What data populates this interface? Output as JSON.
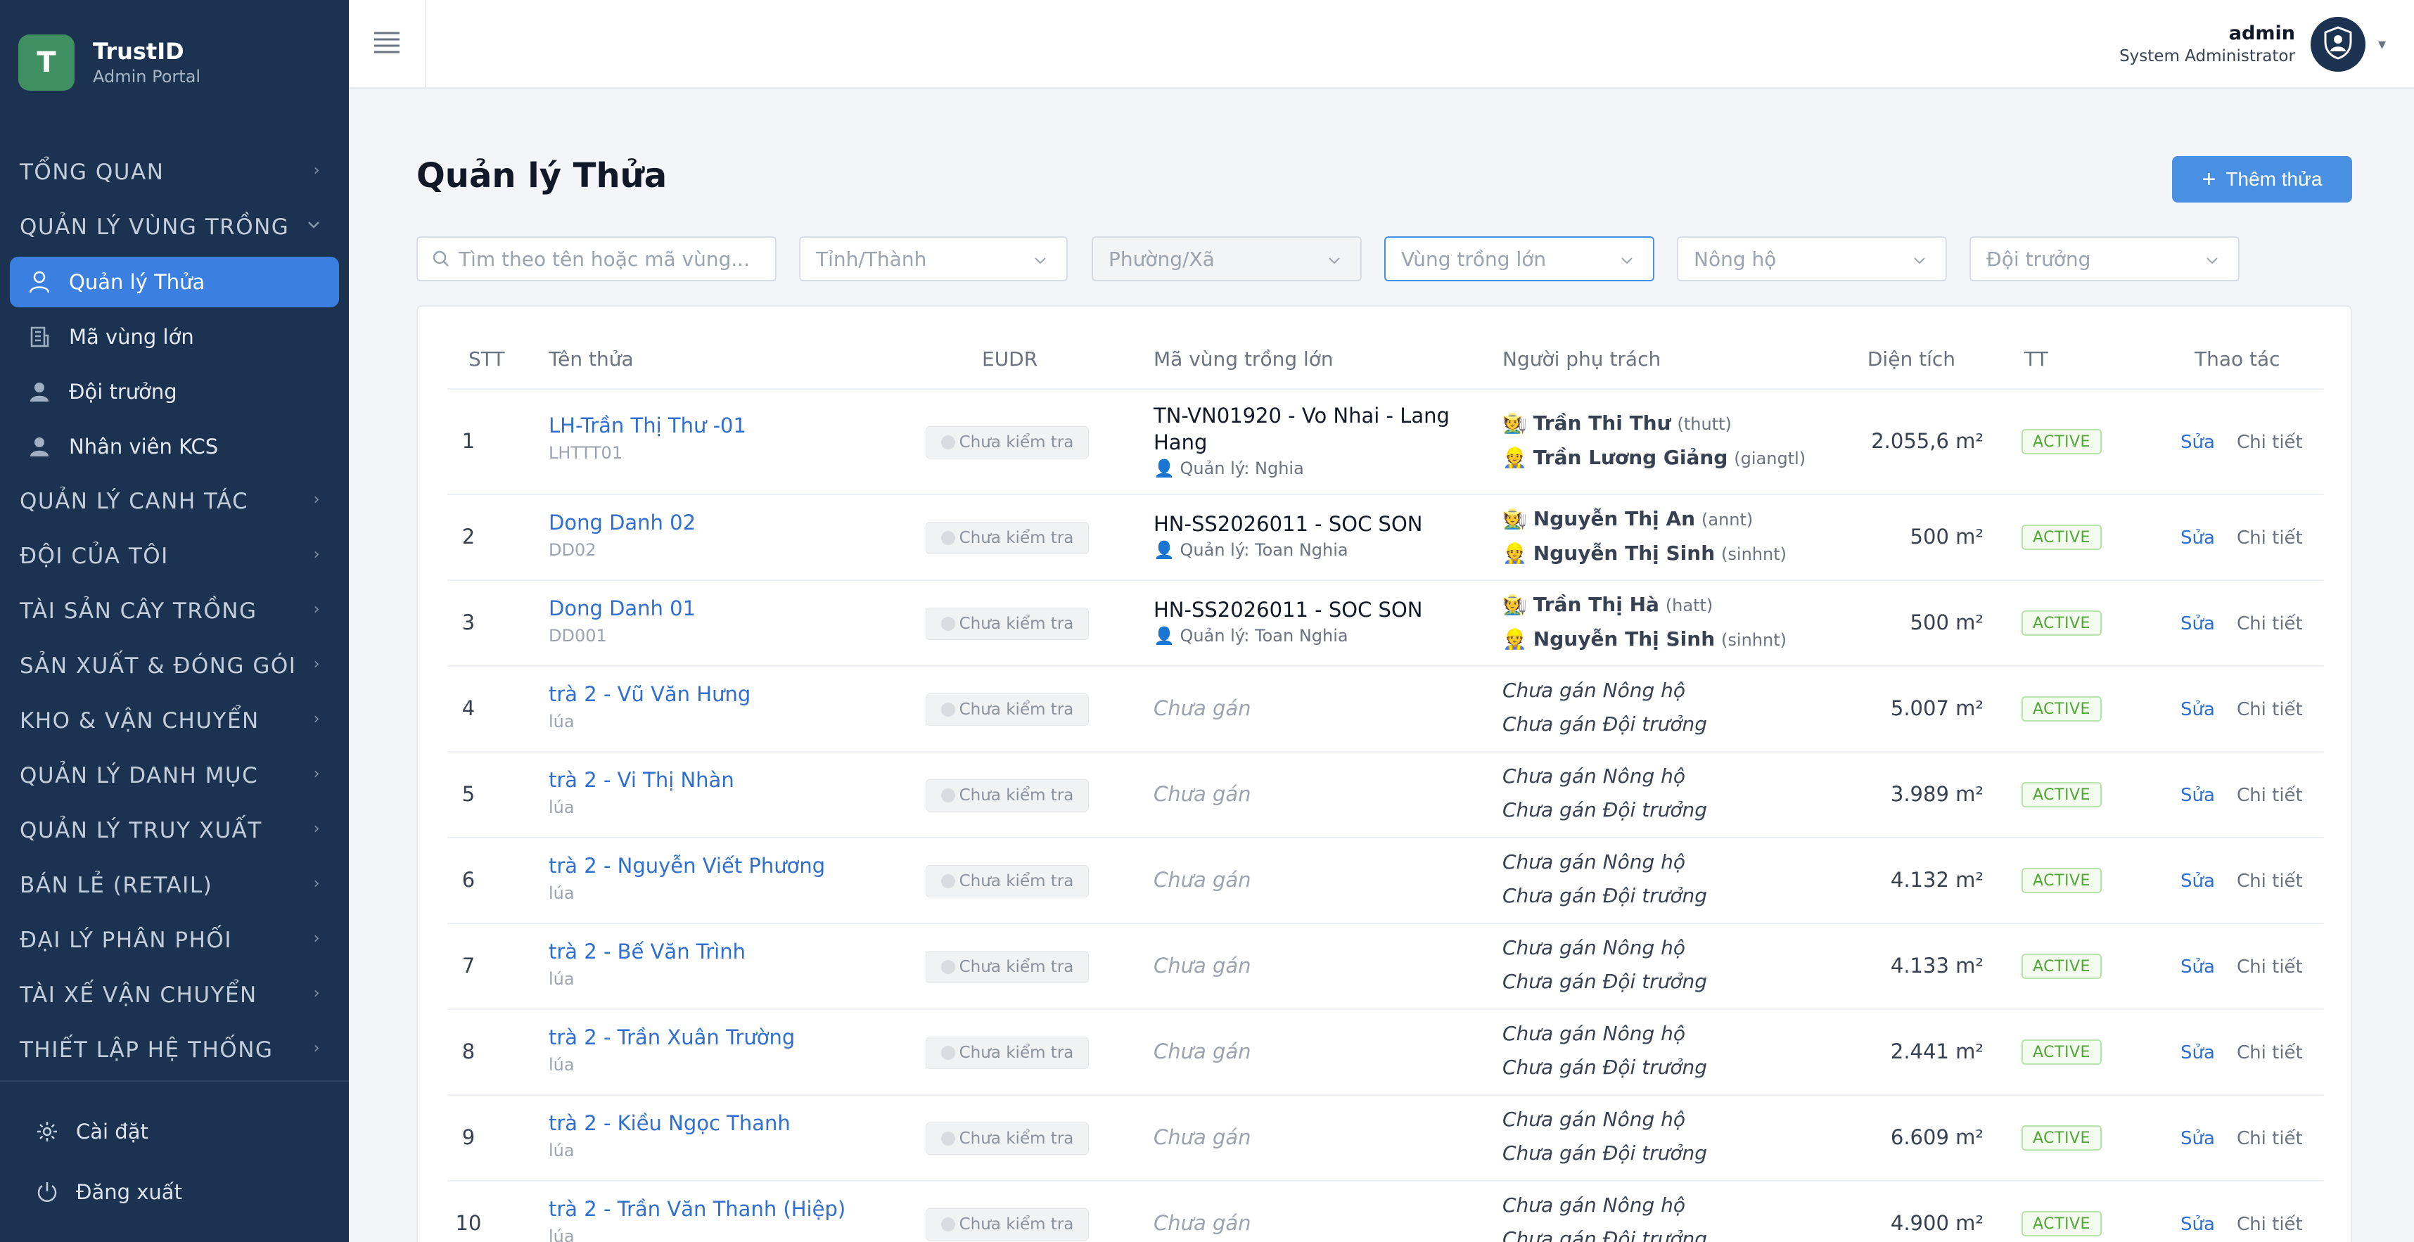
{
  "brand": {
    "logo_letter": "T",
    "name": "TrustID",
    "subtitle": "Admin Portal"
  },
  "nav": {
    "groups_top": [
      {
        "label": "TỔNG QUAN",
        "expanded": false
      },
      {
        "label": "QUẢN LÝ VÙNG TRỒNG",
        "expanded": true
      }
    ],
    "sub_items": [
      {
        "label": "Quản lý Thửa",
        "icon": "land-icon",
        "active": true
      },
      {
        "label": "Mã vùng lớn",
        "icon": "building-icon",
        "active": false
      },
      {
        "label": "Đội trưởng",
        "icon": "user-icon",
        "active": false
      },
      {
        "label": "Nhân viên KCS",
        "icon": "user-icon",
        "active": false
      }
    ],
    "groups_bottom": [
      {
        "label": "QUẢN LÝ CANH TÁC"
      },
      {
        "label": "ĐỘI CỦA TÔI"
      },
      {
        "label": "TÀI SẢN CÂY TRỒNG"
      },
      {
        "label": "SẢN XUẤT & ĐÓNG GÓI"
      },
      {
        "label": "KHO & VẬN CHUYỂN"
      },
      {
        "label": "QUẢN LÝ DANH MỤC"
      },
      {
        "label": "QUẢN LÝ TRUY XUẤT"
      },
      {
        "label": "BÁN LẺ (RETAIL)"
      },
      {
        "label": "ĐẠI LÝ PHÂN PHỐI"
      },
      {
        "label": "TÀI XẾ VẬN CHUYỂN"
      },
      {
        "label": "THIẾT LẬP HỆ THỐNG"
      }
    ],
    "settings_label": "Cài đặt",
    "logout_label": "Đăng xuất"
  },
  "header": {
    "user_name": "admin",
    "user_role": "System Administrator"
  },
  "page": {
    "title": "Quản lý Thửa",
    "add_button": "Thêm thửa"
  },
  "filters": {
    "search_placeholder": "Tìm theo tên hoặc mã vùng...",
    "province": "Tỉnh/Thành",
    "ward": "Phường/Xã",
    "zone": "Vùng trồng lớn",
    "farmer": "Nông hộ",
    "leader": "Đội trưởng"
  },
  "table": {
    "columns": {
      "stt": "STT",
      "name": "Tên thửa",
      "eudr": "EUDR",
      "zone": "Mã vùng trồng lớn",
      "owner": "Người phụ trách",
      "area": "Diện tích",
      "status": "TT",
      "actions": "Thao tác"
    },
    "edit_label": "Sửa",
    "detail_label": "Chi tiết",
    "rows": [
      {
        "stt": "1",
        "name": "LH-Trần Thị Thư -01",
        "code": "LHTTT01",
        "eudr": "Chưa kiểm tra",
        "zone": "TN-VN01920 - Vo Nhai - Lang Hang",
        "zone_manager": "Quản lý: Nghia",
        "farmer": "Trần Thi Thư",
        "farmer_user": "(thutt)",
        "leader": "Trần Lương Giảng",
        "leader_user": "(giangtl)",
        "area": "2.055,6 m²",
        "status": "ACTIVE"
      },
      {
        "stt": "2",
        "name": "Dong Danh 02",
        "code": "DD02",
        "eudr": "Chưa kiểm tra",
        "zone": "HN-SS2026011 - SOC SON",
        "zone_manager": "Quản lý: Toan Nghia",
        "farmer": "Nguyễn Thị An",
        "farmer_user": "(annt)",
        "leader": "Nguyễn Thị Sinh",
        "leader_user": "(sinhnt)",
        "area": "500 m²",
        "status": "ACTIVE"
      },
      {
        "stt": "3",
        "name": "Dong Danh 01",
        "code": "DD001",
        "eudr": "Chưa kiểm tra",
        "zone": "HN-SS2026011 - SOC SON",
        "zone_manager": "Quản lý: Toan Nghia",
        "farmer": "Trần Thị Hà",
        "farmer_user": "(hatt)",
        "leader": "Nguyễn Thị Sinh",
        "leader_user": "(sinhnt)",
        "area": "500 m²",
        "status": "ACTIVE"
      },
      {
        "stt": "4",
        "name": "trà 2 - Vũ Văn Hưng",
        "code": "lúa",
        "eudr": "Chưa kiểm tra",
        "zone_unassigned": "Chưa gán",
        "farmer_unassigned": "Chưa gán Nông hộ",
        "leader_unassigned": "Chưa gán Đội trưởng",
        "area": "5.007 m²",
        "status": "ACTIVE"
      },
      {
        "stt": "5",
        "name": "trà 2 - Vi Thị Nhàn",
        "code": "lúa",
        "eudr": "Chưa kiểm tra",
        "zone_unassigned": "Chưa gán",
        "farmer_unassigned": "Chưa gán Nông hộ",
        "leader_unassigned": "Chưa gán Đội trưởng",
        "area": "3.989 m²",
        "status": "ACTIVE"
      },
      {
        "stt": "6",
        "name": "trà 2 - Nguyễn Viết Phương",
        "code": "lúa",
        "eudr": "Chưa kiểm tra",
        "zone_unassigned": "Chưa gán",
        "farmer_unassigned": "Chưa gán Nông hộ",
        "leader_unassigned": "Chưa gán Đội trưởng",
        "area": "4.132 m²",
        "status": "ACTIVE"
      },
      {
        "stt": "7",
        "name": "trà 2 - Bế Văn Trình",
        "code": "lúa",
        "eudr": "Chưa kiểm tra",
        "zone_unassigned": "Chưa gán",
        "farmer_unassigned": "Chưa gán Nông hộ",
        "leader_unassigned": "Chưa gán Đội trưởng",
        "area": "4.133 m²",
        "status": "ACTIVE"
      },
      {
        "stt": "8",
        "name": "trà 2 - Trần Xuân Trường",
        "code": "lúa",
        "eudr": "Chưa kiểm tra",
        "zone_unassigned": "Chưa gán",
        "farmer_unassigned": "Chưa gán Nông hộ",
        "leader_unassigned": "Chưa gán Đội trưởng",
        "area": "2.441 m²",
        "status": "ACTIVE"
      },
      {
        "stt": "9",
        "name": "trà 2 - Kiều Ngọc Thanh",
        "code": "lúa",
        "eudr": "Chưa kiểm tra",
        "zone_unassigned": "Chưa gán",
        "farmer_unassigned": "Chưa gán Nông hộ",
        "leader_unassigned": "Chưa gán Đội trưởng",
        "area": "6.609 m²",
        "status": "ACTIVE"
      },
      {
        "stt": "10",
        "name": "trà 2 - Trần Văn Thanh (Hiệp)",
        "code": "lúa",
        "eudr": "Chưa kiểm tra",
        "zone_unassigned": "Chưa gán",
        "farmer_unassigned": "Chưa gán Nông hộ",
        "leader_unassigned": "Chưa gán Đội trưởng",
        "area": "4.900 m²",
        "status": "ACTIVE"
      }
    ]
  }
}
